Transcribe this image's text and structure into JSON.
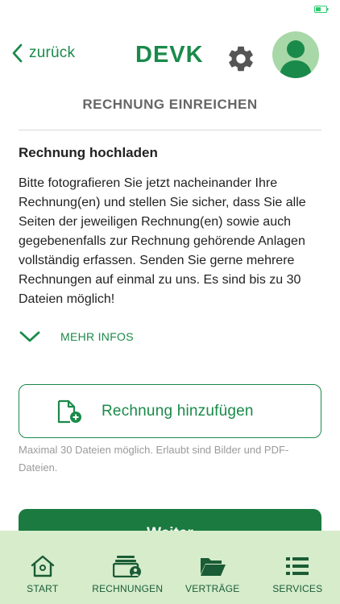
{
  "header": {
    "back_label": "zurück",
    "logo_text": "DEVK"
  },
  "page": {
    "title": "RECHNUNG EINREICHEN",
    "section_heading": "Rechnung hochladen",
    "body_text": "Bitte fotografieren Sie jetzt nacheinander Ihre Rechnung(en) und stellen Sie sicher, dass Sie alle Seiten der jeweiligen Rechnung(en) sowie auch gegebenenfalls zur Rechnung gehörende Anlagen vollständig erfassen. Senden Sie gerne mehrere Rechnungen auf einmal zu uns. Es sind bis zu 30 Dateien möglich!",
    "more_info_label": "MEHR INFOS",
    "add_invoice_label": "Rechnung hinzufügen",
    "hint_text": "Maximal 30 Dateien möglich. Erlaubt sind Bilder und PDF-Dateien.",
    "next_button_label": "Weiter"
  },
  "bottom_nav": {
    "items": [
      {
        "label": "START",
        "icon": "home-icon"
      },
      {
        "label": "RECHNUNGEN",
        "icon": "invoices-icon"
      },
      {
        "label": "VERTRÄGE",
        "icon": "folder-icon"
      },
      {
        "label": "SERVICES",
        "icon": "list-icon"
      }
    ]
  },
  "colors": {
    "brand_green": "#1a8a4a",
    "nav_background": "#d6eccb",
    "avatar_background": "#a8d8a8"
  }
}
